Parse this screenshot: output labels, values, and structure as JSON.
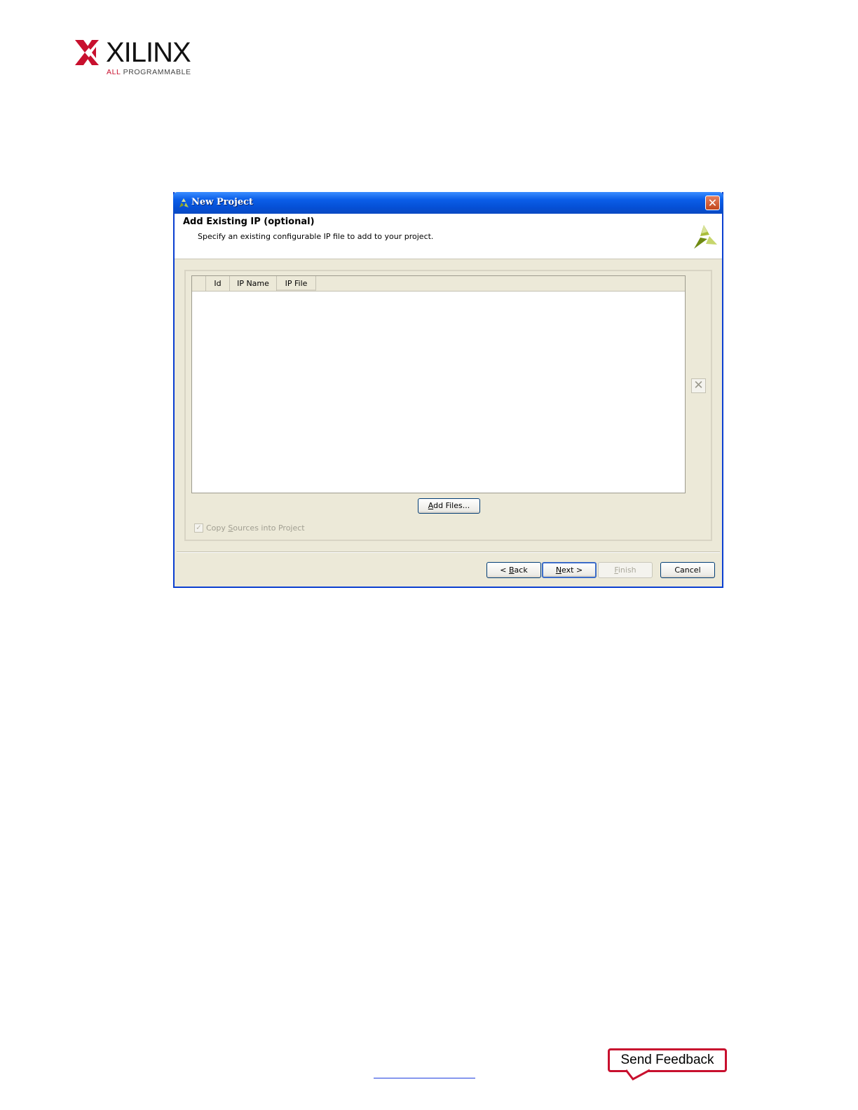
{
  "logo": {
    "brand": "XILINX",
    "tagline_prefix": "ALL",
    "tagline_rest": " PROGRAMMABLE"
  },
  "dialog": {
    "title": "New Project",
    "title_icon": "xilinx-icon",
    "close_icon": "close-icon",
    "header_title": "Add Existing IP (optional)",
    "header_subtitle": "Specify an existing configurable IP file to add to your project.",
    "table": {
      "columns": [
        "",
        "Id",
        "IP Name",
        "IP File"
      ],
      "rows": []
    },
    "remove_icon": "close-icon",
    "add_files_label": "Add Files...",
    "copy_sources": {
      "label": "Copy Sources into Project",
      "checked": true,
      "disabled": true
    },
    "buttons": {
      "back": "< Back",
      "next": "Next >",
      "finish": "Finish",
      "cancel": "Cancel"
    }
  },
  "footer": {
    "feedback_label": "Send Feedback"
  },
  "colors": {
    "brand_red": "#c8102e",
    "titlebar_blue": "#0b5ee8",
    "dialog_bg": "#ece9d8"
  }
}
